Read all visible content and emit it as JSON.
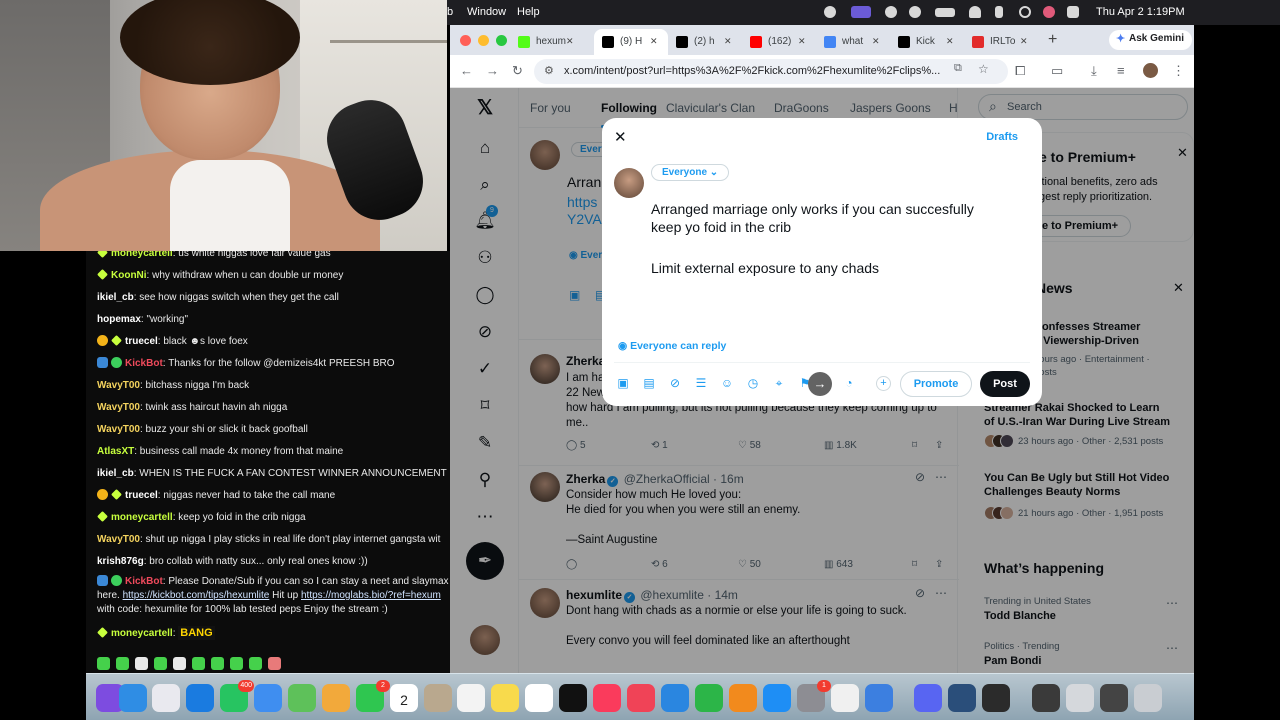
{
  "menubar": {
    "left_items": [
      "b",
      "Window",
      "Help"
    ],
    "datetime": "Thu Apr 2  1:19PM"
  },
  "browser": {
    "tabs": [
      {
        "label": "hexum",
        "icon": "kick-favicon",
        "color": "#53fc18"
      },
      {
        "label": "(9) H",
        "icon": "x-favicon",
        "color": "#000000"
      },
      {
        "label": "(2) h",
        "icon": "x-favicon",
        "color": "#000000"
      },
      {
        "label": "(162)",
        "icon": "youtube-favicon",
        "color": "#ff0000"
      },
      {
        "label": "what",
        "icon": "google-favicon",
        "color": "#4285f4"
      },
      {
        "label": "Kick",
        "icon": "kick-favicon",
        "color": "#000000"
      },
      {
        "label": "IRLTo",
        "icon": "yandex-favicon",
        "color": "#e22b2b"
      }
    ],
    "gemini_label": "Ask Gemini",
    "url": "x.com/intent/post?url=https%3A%2F%2Fkick.com%2Fhexumlite%2Fclips%..."
  },
  "x": {
    "tabs": [
      "For you",
      "Following",
      "Clavicular's Clan",
      "DraGoons",
      "Jaspers Goons",
      "H"
    ],
    "notification_count": "9",
    "search_placeholder": "Search",
    "background_post": {
      "audience": "Every",
      "text_fragment": "Arran",
      "link_fragment1": "https",
      "link_fragment2": "Y2VA",
      "reply_fragment": "Every"
    },
    "posts": [
      {
        "name": "Zherka",
        "handle": "",
        "time": "",
        "text_lines": [
          "I am ha",
          "22 New",
          "how hard I am pulling, but its not pulling because they keep coming up to",
          "me.."
        ],
        "replies": "5",
        "reposts": "1",
        "likes": "58",
        "views": "1.8K"
      },
      {
        "name": "Zherka",
        "handle": "@ZherkaOfficial · 16m",
        "text_lines": [
          "Consider how much He loved you:",
          "He died for you when you were still an enemy.",
          "",
          "—Saint Augustine"
        ],
        "replies": "",
        "reposts": "6",
        "likes": "50",
        "views": "643"
      },
      {
        "name": "hexumlite",
        "handle": "@hexumlite · 14m",
        "text_lines": [
          "Dont hang with chads as a normie or else your life is going to suck.",
          "",
          "Every convo you will feel dominated like an afterthought"
        ]
      }
    ],
    "premium": {
      "title": "e to Premium+",
      "line1": "itional benefits, zero ads",
      "line2": "gest reply prioritization.",
      "button": "e to Premium+"
    },
    "news": {
      "title": "News",
      "items": [
        {
          "title_lines": [
            "Confesses Streamer",
            "e Viewership-Driven"
          ],
          "meta_lines": [
            "hours ago · Entertainment ·",
            "posts"
          ]
        },
        {
          "title_lines": [
            "Streamer Rakai Shocked to Learn",
            "of U.S.-Iran War During Live Stream"
          ],
          "meta_lines": [
            "23 hours ago · Other · 2,531 posts"
          ]
        },
        {
          "title_lines": [
            "You Can Be Ugly but Still Hot Video",
            "Challenges Beauty Norms"
          ],
          "meta_lines": [
            "21 hours ago · Other · 1,951 posts"
          ]
        }
      ]
    },
    "happening": {
      "title": "What’s happening",
      "items": [
        {
          "context": "Trending in United States",
          "name": "Todd Blanche"
        },
        {
          "context": "Politics · Trending",
          "name": "Pam Bondi"
        }
      ]
    },
    "compose": {
      "drafts": "Drafts",
      "audience": "Everyone",
      "text_line1": "Arranged marriage only works if you can succesfully",
      "text_line2": "keep yo foid in the crib",
      "text_line3": "Limit external exposure to any chads",
      "reply_setting": "Everyone can reply",
      "promote": "Promote",
      "post": "Post"
    }
  },
  "chat": {
    "messages": [
      {
        "badges": [
          "star"
        ],
        "user": "moneycartell",
        "color": "#c7ff3d",
        "text": "us white niggas love fair value gas"
      },
      {
        "badges": [
          "star"
        ],
        "user": "KoonNi",
        "color": "#c7ff3d",
        "text": "why withdraw when u can double ur money"
      },
      {
        "badges": [],
        "user": "ikiel_cb",
        "color": "#ffffff",
        "text": "see how niggas switch when they get the call"
      },
      {
        "badges": [],
        "user": "hopemax",
        "color": "#ffffff",
        "text": "\"working\""
      },
      {
        "badges": [
          "gold",
          "star"
        ],
        "user": "truecel",
        "color": "#ffffff",
        "text": "black ☻s love foex"
      },
      {
        "badges": [
          "bot",
          "green"
        ],
        "user": "KickBot",
        "color": "#f04a5c",
        "text": "Thanks for the follow @demizeis4kt PREESH BRO"
      },
      {
        "badges": [],
        "user": "WavyT00",
        "color": "#f4d35e",
        "text": "bitchass nigga I'm back"
      },
      {
        "badges": [],
        "user": "WavyT00",
        "color": "#f4d35e",
        "text": "twink ass haircut havin ah nigga"
      },
      {
        "badges": [],
        "user": "WavyT00",
        "color": "#f4d35e",
        "text": "buzz your shi or slick it back goofball"
      },
      {
        "badges": [],
        "user": "AtlasXT",
        "color": "#c7ff3d",
        "text": "business call made 4x money from that maine"
      },
      {
        "badges": [],
        "user": "ikiel_cb",
        "color": "#ffffff",
        "text": "WHEN IS THE FUCK A FAN CONTEST WINNER ANNOUNCEMENT"
      },
      {
        "badges": [
          "gold",
          "star"
        ],
        "user": "truecel",
        "color": "#ffffff",
        "text": "niggas never had to take the call mane"
      },
      {
        "badges": [
          "star"
        ],
        "user": "moneycartell",
        "color": "#c7ff3d",
        "text": "keep yo foid in the crib nigga"
      },
      {
        "badges": [],
        "user": "WavyT00",
        "color": "#f4d35e",
        "text": "shut up nigga I play sticks in real life don't play internet gangsta wit"
      },
      {
        "badges": [],
        "user": "krish876g",
        "color": "#ffffff",
        "text": "bro collab with natty sux... only real ones know :))"
      }
    ],
    "kickbot2": {
      "user": "KickBot",
      "text1": "Please Donate/Sub if you can so I can stay a neet and slaymax",
      "text2": "here.",
      "link1": "https://kickbot.com/tips/hexumlite",
      "text3": "Hit up",
      "link2": "https://moglabs.bio/?ref=hexum",
      "text4": "with code: hexumlite for 100% lab tested peps Enjoy the stream :)"
    },
    "last": {
      "user": "moneycartell",
      "emote": "BANG"
    }
  },
  "dock": {
    "badges": {
      "whatsapp": "400",
      "facetime": "2",
      "calendar_day": "2",
      "settings": "1"
    }
  }
}
